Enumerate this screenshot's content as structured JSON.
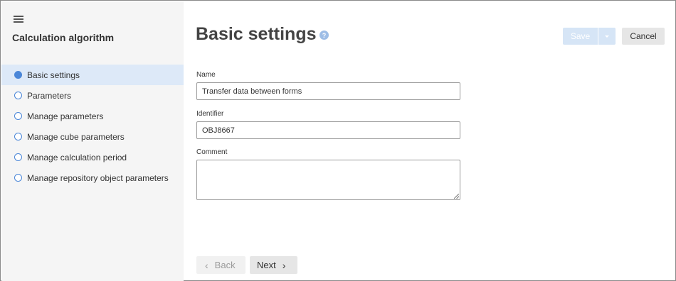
{
  "sidebar": {
    "title": "Calculation algorithm",
    "menu_icon": "hamburger-menu-icon",
    "steps": [
      {
        "label": "Basic settings",
        "active": true
      },
      {
        "label": "Parameters",
        "active": false
      },
      {
        "label": "Manage parameters",
        "active": false
      },
      {
        "label": "Manage cube parameters",
        "active": false
      },
      {
        "label": "Manage calculation period",
        "active": false
      },
      {
        "label": "Manage repository object parameters",
        "active": false
      }
    ]
  },
  "main": {
    "title": "Basic settings",
    "help_icon": "?",
    "toolbar": {
      "save_label": "Save",
      "save_enabled": false,
      "cancel_label": "Cancel"
    },
    "fields": {
      "name": {
        "label": "Name",
        "value": "Transfer data between forms"
      },
      "identifier": {
        "label": "Identifier",
        "value": "OBJ8667"
      },
      "comment": {
        "label": "Comment",
        "value": ""
      }
    },
    "footer": {
      "back_label": "Back",
      "back_enabled": false,
      "next_label": "Next"
    }
  },
  "colors": {
    "accent": "#4a86d8",
    "active_step_bg": "#dde9f8",
    "sidebar_bg": "#f5f5f5",
    "disabled_primary": "#d6e5f6"
  }
}
